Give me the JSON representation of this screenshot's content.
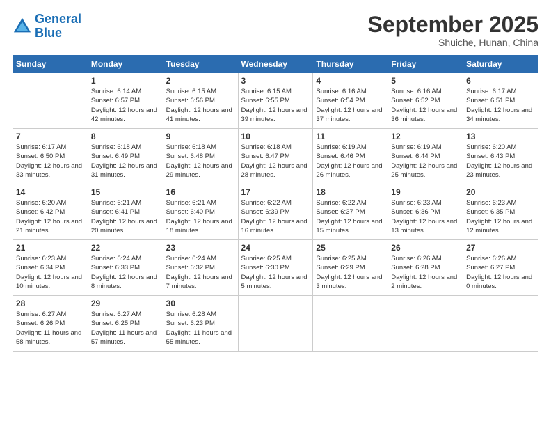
{
  "header": {
    "logo_line1": "General",
    "logo_line2": "Blue",
    "month": "September 2025",
    "location": "Shuiche, Hunan, China"
  },
  "days_of_week": [
    "Sunday",
    "Monday",
    "Tuesday",
    "Wednesday",
    "Thursday",
    "Friday",
    "Saturday"
  ],
  "weeks": [
    [
      {
        "day": "",
        "sunrise": "",
        "sunset": "",
        "daylight": ""
      },
      {
        "day": "1",
        "sunrise": "Sunrise: 6:14 AM",
        "sunset": "Sunset: 6:57 PM",
        "daylight": "Daylight: 12 hours and 42 minutes."
      },
      {
        "day": "2",
        "sunrise": "Sunrise: 6:15 AM",
        "sunset": "Sunset: 6:56 PM",
        "daylight": "Daylight: 12 hours and 41 minutes."
      },
      {
        "day": "3",
        "sunrise": "Sunrise: 6:15 AM",
        "sunset": "Sunset: 6:55 PM",
        "daylight": "Daylight: 12 hours and 39 minutes."
      },
      {
        "day": "4",
        "sunrise": "Sunrise: 6:16 AM",
        "sunset": "Sunset: 6:54 PM",
        "daylight": "Daylight: 12 hours and 37 minutes."
      },
      {
        "day": "5",
        "sunrise": "Sunrise: 6:16 AM",
        "sunset": "Sunset: 6:52 PM",
        "daylight": "Daylight: 12 hours and 36 minutes."
      },
      {
        "day": "6",
        "sunrise": "Sunrise: 6:17 AM",
        "sunset": "Sunset: 6:51 PM",
        "daylight": "Daylight: 12 hours and 34 minutes."
      }
    ],
    [
      {
        "day": "7",
        "sunrise": "Sunrise: 6:17 AM",
        "sunset": "Sunset: 6:50 PM",
        "daylight": "Daylight: 12 hours and 33 minutes."
      },
      {
        "day": "8",
        "sunrise": "Sunrise: 6:18 AM",
        "sunset": "Sunset: 6:49 PM",
        "daylight": "Daylight: 12 hours and 31 minutes."
      },
      {
        "day": "9",
        "sunrise": "Sunrise: 6:18 AM",
        "sunset": "Sunset: 6:48 PM",
        "daylight": "Daylight: 12 hours and 29 minutes."
      },
      {
        "day": "10",
        "sunrise": "Sunrise: 6:18 AM",
        "sunset": "Sunset: 6:47 PM",
        "daylight": "Daylight: 12 hours and 28 minutes."
      },
      {
        "day": "11",
        "sunrise": "Sunrise: 6:19 AM",
        "sunset": "Sunset: 6:46 PM",
        "daylight": "Daylight: 12 hours and 26 minutes."
      },
      {
        "day": "12",
        "sunrise": "Sunrise: 6:19 AM",
        "sunset": "Sunset: 6:44 PM",
        "daylight": "Daylight: 12 hours and 25 minutes."
      },
      {
        "day": "13",
        "sunrise": "Sunrise: 6:20 AM",
        "sunset": "Sunset: 6:43 PM",
        "daylight": "Daylight: 12 hours and 23 minutes."
      }
    ],
    [
      {
        "day": "14",
        "sunrise": "Sunrise: 6:20 AM",
        "sunset": "Sunset: 6:42 PM",
        "daylight": "Daylight: 12 hours and 21 minutes."
      },
      {
        "day": "15",
        "sunrise": "Sunrise: 6:21 AM",
        "sunset": "Sunset: 6:41 PM",
        "daylight": "Daylight: 12 hours and 20 minutes."
      },
      {
        "day": "16",
        "sunrise": "Sunrise: 6:21 AM",
        "sunset": "Sunset: 6:40 PM",
        "daylight": "Daylight: 12 hours and 18 minutes."
      },
      {
        "day": "17",
        "sunrise": "Sunrise: 6:22 AM",
        "sunset": "Sunset: 6:39 PM",
        "daylight": "Daylight: 12 hours and 16 minutes."
      },
      {
        "day": "18",
        "sunrise": "Sunrise: 6:22 AM",
        "sunset": "Sunset: 6:37 PM",
        "daylight": "Daylight: 12 hours and 15 minutes."
      },
      {
        "day": "19",
        "sunrise": "Sunrise: 6:23 AM",
        "sunset": "Sunset: 6:36 PM",
        "daylight": "Daylight: 12 hours and 13 minutes."
      },
      {
        "day": "20",
        "sunrise": "Sunrise: 6:23 AM",
        "sunset": "Sunset: 6:35 PM",
        "daylight": "Daylight: 12 hours and 12 minutes."
      }
    ],
    [
      {
        "day": "21",
        "sunrise": "Sunrise: 6:23 AM",
        "sunset": "Sunset: 6:34 PM",
        "daylight": "Daylight: 12 hours and 10 minutes."
      },
      {
        "day": "22",
        "sunrise": "Sunrise: 6:24 AM",
        "sunset": "Sunset: 6:33 PM",
        "daylight": "Daylight: 12 hours and 8 minutes."
      },
      {
        "day": "23",
        "sunrise": "Sunrise: 6:24 AM",
        "sunset": "Sunset: 6:32 PM",
        "daylight": "Daylight: 12 hours and 7 minutes."
      },
      {
        "day": "24",
        "sunrise": "Sunrise: 6:25 AM",
        "sunset": "Sunset: 6:30 PM",
        "daylight": "Daylight: 12 hours and 5 minutes."
      },
      {
        "day": "25",
        "sunrise": "Sunrise: 6:25 AM",
        "sunset": "Sunset: 6:29 PM",
        "daylight": "Daylight: 12 hours and 3 minutes."
      },
      {
        "day": "26",
        "sunrise": "Sunrise: 6:26 AM",
        "sunset": "Sunset: 6:28 PM",
        "daylight": "Daylight: 12 hours and 2 minutes."
      },
      {
        "day": "27",
        "sunrise": "Sunrise: 6:26 AM",
        "sunset": "Sunset: 6:27 PM",
        "daylight": "Daylight: 12 hours and 0 minutes."
      }
    ],
    [
      {
        "day": "28",
        "sunrise": "Sunrise: 6:27 AM",
        "sunset": "Sunset: 6:26 PM",
        "daylight": "Daylight: 11 hours and 58 minutes."
      },
      {
        "day": "29",
        "sunrise": "Sunrise: 6:27 AM",
        "sunset": "Sunset: 6:25 PM",
        "daylight": "Daylight: 11 hours and 57 minutes."
      },
      {
        "day": "30",
        "sunrise": "Sunrise: 6:28 AM",
        "sunset": "Sunset: 6:23 PM",
        "daylight": "Daylight: 11 hours and 55 minutes."
      },
      {
        "day": "",
        "sunrise": "",
        "sunset": "",
        "daylight": ""
      },
      {
        "day": "",
        "sunrise": "",
        "sunset": "",
        "daylight": ""
      },
      {
        "day": "",
        "sunrise": "",
        "sunset": "",
        "daylight": ""
      },
      {
        "day": "",
        "sunrise": "",
        "sunset": "",
        "daylight": ""
      }
    ]
  ]
}
